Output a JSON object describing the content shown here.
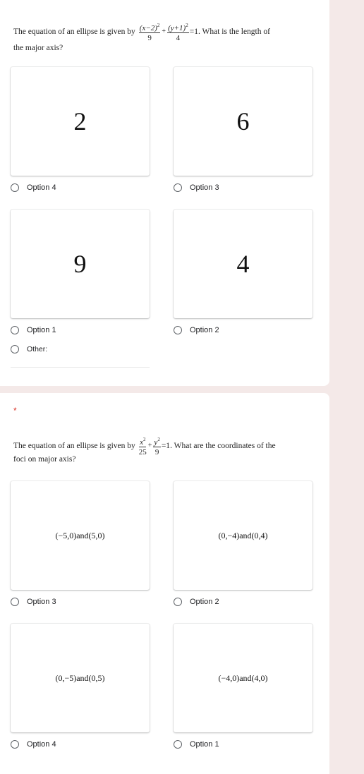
{
  "colors": {
    "page_background": "#f4e9e8",
    "card_background": "#ffffff",
    "required_star": "#d93025",
    "radio_border": "#5f6368",
    "label_text": "#202124"
  },
  "questions": [
    {
      "required": false,
      "text_before": "The equation of an ellipse is given by",
      "equation": {
        "term1_num": "(x−2)",
        "term1_exp": "2",
        "term1_den": "9",
        "operator": "+",
        "term2_num": "(y+1)",
        "term2_exp": "2",
        "term2_den": "4",
        "rhs": "=1"
      },
      "text_after": ". What is the length of",
      "text_line2": "the major axis?",
      "options": [
        {
          "image_text": "2",
          "label": "Option 4"
        },
        {
          "image_text": "6",
          "label": "Option 3"
        },
        {
          "image_text": "9",
          "label": "Option 1"
        },
        {
          "image_text": "4",
          "label": "Option 2"
        }
      ],
      "other_label": "Other:"
    },
    {
      "required": true,
      "required_mark": "*",
      "text_before": "The equation of an ellipse is given by",
      "equation": {
        "term1_num": "x",
        "term1_exp": "2",
        "term1_den": "25",
        "operator": "+",
        "term2_num": "y",
        "term2_exp": "2",
        "term2_den": "9",
        "rhs": "=1"
      },
      "text_after": ". What are the coordinates of the",
      "text_line2": "foci on major axis?",
      "options": [
        {
          "image_text": "(−5,0)and(5,0)",
          "label": "Option 3"
        },
        {
          "image_text": "(0,−4)and(0,4)",
          "label": "Option 2"
        },
        {
          "image_text": "(0,−5)and(0,5)",
          "label": "Option 4"
        },
        {
          "image_text": "(−4,0)and(4,0)",
          "label": "Option 1"
        }
      ]
    }
  ]
}
